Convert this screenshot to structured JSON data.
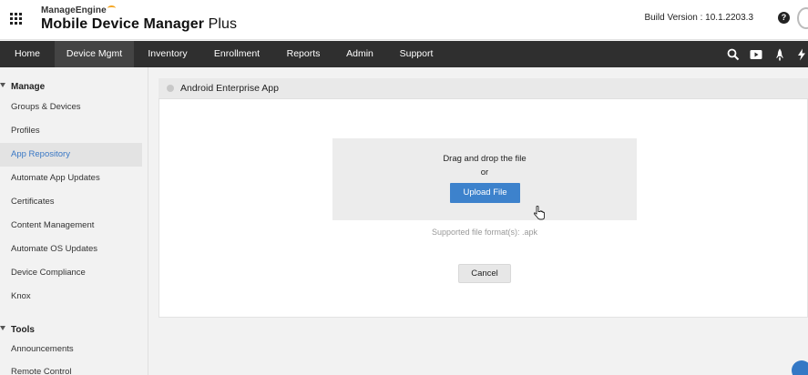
{
  "app": {
    "brand_small": "ManageEngine",
    "brand_name_bold": "Mobile Device Manager",
    "brand_name_plus": " Plus",
    "build_label": "Build Version :",
    "build_version": "10.1.2203.3",
    "help_glyph": "?"
  },
  "nav": {
    "items": [
      {
        "label": "Home",
        "active": false
      },
      {
        "label": "Device Mgmt",
        "active": true
      },
      {
        "label": "Inventory",
        "active": false
      },
      {
        "label": "Enrollment",
        "active": false
      },
      {
        "label": "Reports",
        "active": false
      },
      {
        "label": "Admin",
        "active": false
      },
      {
        "label": "Support",
        "active": false
      }
    ],
    "icons": [
      "search-icon",
      "video-icon",
      "rocket-icon",
      "lightning-icon"
    ]
  },
  "sidebar": {
    "sections": [
      {
        "title": "Manage",
        "items": [
          {
            "label": "Groups & Devices",
            "active": false
          },
          {
            "label": "Profiles",
            "active": false
          },
          {
            "label": "App Repository",
            "active": true
          },
          {
            "label": "Automate App Updates",
            "active": false
          },
          {
            "label": "Certificates",
            "active": false
          },
          {
            "label": "Content Management",
            "active": false
          },
          {
            "label": "Automate OS Updates",
            "active": false
          },
          {
            "label": "Device Compliance",
            "active": false
          },
          {
            "label": "Knox",
            "active": false
          }
        ]
      },
      {
        "title": "Tools",
        "items": [
          {
            "label": "Announcements",
            "active": false
          },
          {
            "label": "Remote Control",
            "active": false
          }
        ]
      }
    ]
  },
  "main": {
    "panel_title": "Android Enterprise App",
    "dropzone_line1": "Drag and drop the file",
    "dropzone_line2": "or",
    "upload_button": "Upload File",
    "supported_formats": "Supported file format(s): .apk",
    "cancel_button": "Cancel"
  },
  "colors": {
    "nav_bg": "#2f2f2f",
    "active_link": "#3a78c5",
    "primary_button": "#3d82cc",
    "brand_accent": "#f5a623"
  }
}
